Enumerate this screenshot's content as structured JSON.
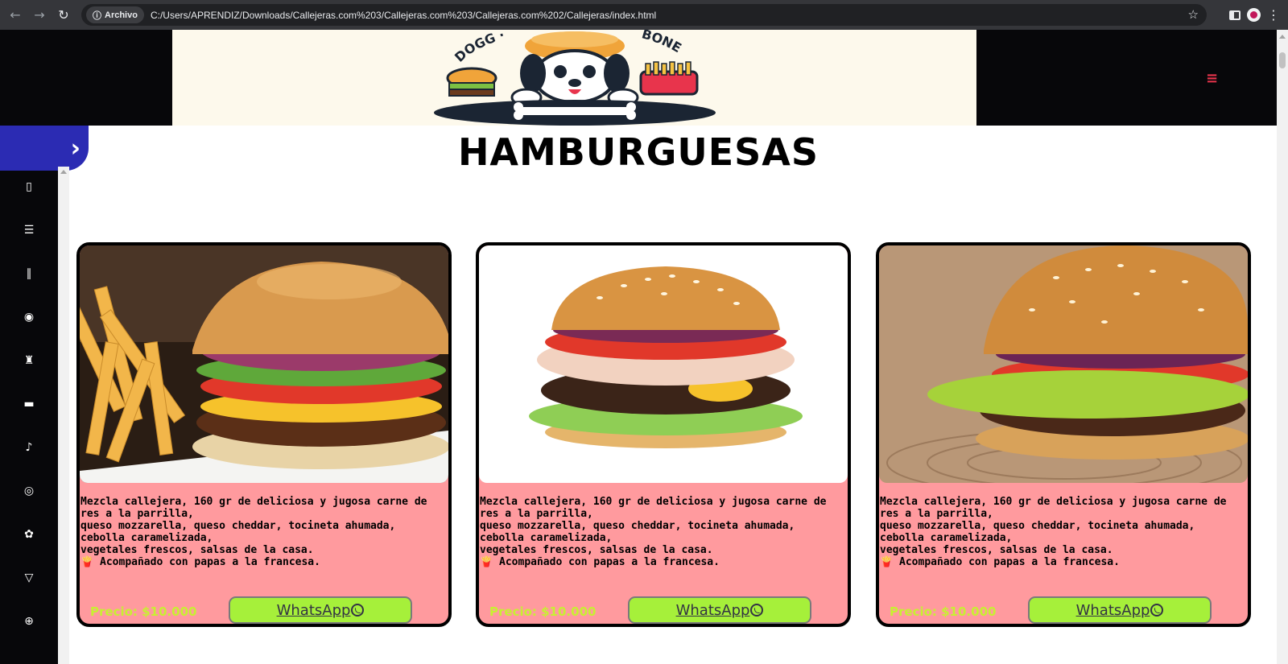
{
  "browser": {
    "site_chip_label": "Archivo",
    "url": "C:/Users/APRENDIZ/Downloads/Callejeras.com%203/Callejeras.com%203/Callejeras.com%202/Callejeras/index.html",
    "nav_icons": [
      "back-arrow-icon",
      "forward-arrow-icon",
      "reload-icon"
    ],
    "right_icons": [
      "bookmark-star-icon",
      "side-panel-icon",
      "profile-avatar",
      "kebab-menu-icon"
    ]
  },
  "header": {
    "logo_text": "DOGG · BONE",
    "menu_icon": "hamburger-menu-icon"
  },
  "sidebar": {
    "toggle_icon": "chevron-right-icon",
    "icons": [
      "menu-book-icon",
      "burger-icon",
      "hotdog-icon",
      "pizza-icon",
      "fries-icon",
      "sandwich-icon",
      "drumstick-icon",
      "donut-icon",
      "salad-icon",
      "drink-icon",
      "plus-circle-icon"
    ]
  },
  "main": {
    "title": "HAMBURGUESAS",
    "cards": [
      {
        "desc_1": "Mezcla callejera, 160 gr de deliciosa y jugosa carne de res a la parrilla,",
        "desc_2": "queso mozzarella, queso cheddar, tocineta ahumada, cebolla caramelizada,",
        "desc_3": "vegetales frescos, salsas de la casa.",
        "desc_4": "🍟 Acompañado con papas a la francesa.",
        "price": "Precio: $10.000",
        "button": "WhatsApp"
      },
      {
        "desc_1": "Mezcla callejera, 160 gr de deliciosa y jugosa carne de res a la parrilla,",
        "desc_2": "queso mozzarella, queso cheddar, tocineta ahumada, cebolla caramelizada,",
        "desc_3": "vegetales frescos, salsas de la casa.",
        "desc_4": "🍟 Acompañado con papas a la francesa.",
        "price": "Precio: $10.000",
        "button": "WhatsApp"
      },
      {
        "desc_1": "Mezcla callejera, 160 gr de deliciosa y jugosa carne de res a la parrilla,",
        "desc_2": "queso mozzarella, queso cheddar, tocineta ahumada, cebolla caramelizada,",
        "desc_3": "vegetales frescos, salsas de la casa.",
        "desc_4": "🍟 Acompañado con papas a la francesa.",
        "price": "Precio: $10.000",
        "button": "WhatsApp"
      }
    ]
  },
  "colors": {
    "card_bg": "#ff9a9e",
    "price": "#c8f032",
    "button_bg": "#a6f03a",
    "sidebar_bg": "#07070a",
    "toggle_bg": "#2b2bb3",
    "menu_icon": "#e8344c"
  }
}
